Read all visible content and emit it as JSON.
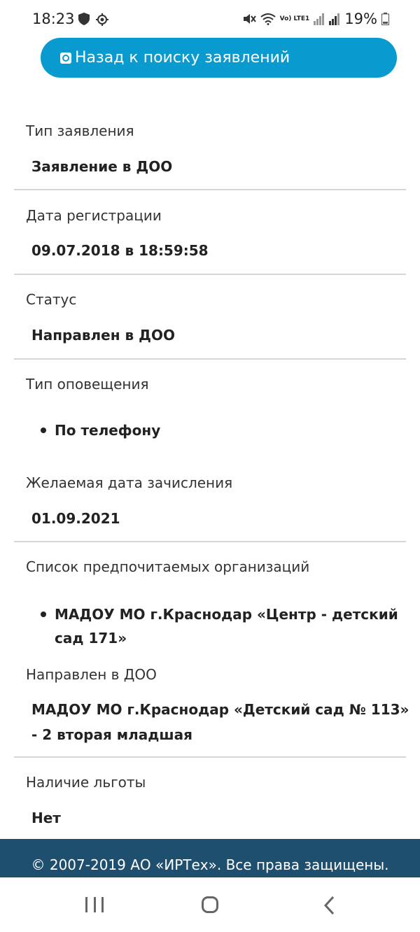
{
  "status_bar": {
    "time": "18:23",
    "battery": "19%",
    "network_label": "Vo) LTE1",
    "icons": [
      "shield-icon",
      "gear-icon",
      "mute-icon",
      "wifi-icon",
      "volte-icon",
      "signal-icon",
      "signal-icon",
      "battery-icon"
    ]
  },
  "header": {
    "back_button_label": "Назад к поиску заявлений",
    "accent_color": "#099bd0"
  },
  "fields": {
    "type": {
      "label": "Тип заявления",
      "value": "Заявление в ДОО"
    },
    "reg_date": {
      "label": "Дата регистрации",
      "value": "09.07.2018 в 18:59:58"
    },
    "status": {
      "label": "Статус",
      "value": "Направлен в ДОО"
    },
    "notification": {
      "label": "Тип оповещения",
      "items": [
        "По телефону"
      ]
    },
    "desired_date": {
      "label": "Желаемая дата зачисления",
      "value": "01.09.2021"
    },
    "preferred_orgs": {
      "label": "Список предпочитаемых организаций",
      "items": [
        "МАДОУ МО г.Краснодар «Центр - детский сад 171»"
      ]
    },
    "assigned": {
      "label": "Направлен в ДОО",
      "value": "МАДОУ МО г.Краснодар «Детский сад № 113» - 2 вторая младшая"
    },
    "benefit": {
      "label": "Наличие льготы",
      "value": "Нет"
    }
  },
  "footer": {
    "text": "© 2007-2019 АО «ИРТех». Все права защищены.",
    "color": "#1f4f6e"
  },
  "nav_bar": {
    "icons": [
      "recent-apps-icon",
      "home-icon",
      "back-icon"
    ]
  }
}
